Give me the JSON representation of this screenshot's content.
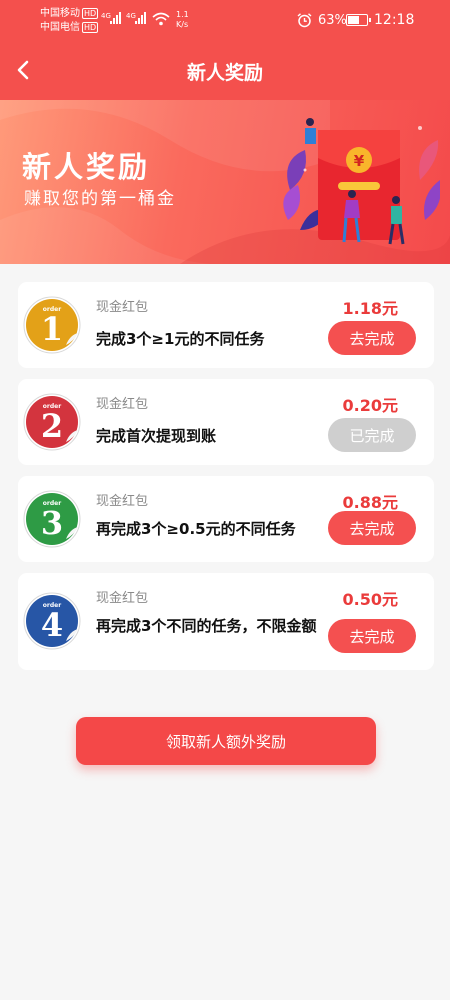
{
  "status_bar": {
    "carrier_1": "中国移动",
    "carrier_2": "中国电信",
    "hd_badge": "HD",
    "network_1": "4G",
    "network_2": "4G",
    "net_speed_value": "1.1",
    "net_speed_unit": "K/s",
    "battery": "63%",
    "battery_level": 0.63,
    "time": "12:18"
  },
  "nav": {
    "back_icon": "chevron-left-icon",
    "title": "新人奖励"
  },
  "banner": {
    "title": "新人奖励",
    "subtitle_prefix": "赚取您的",
    "subtitle_highlight": "第一桶金",
    "envelope_symbol": "¥"
  },
  "tasks": [
    {
      "order": "1",
      "badge_color": "#e3a118",
      "kind": "现金红包",
      "description": "完成3个≥1元的不同任务",
      "amount": "1.18元",
      "button": "去完成",
      "status": "todo"
    },
    {
      "order": "2",
      "badge_color": "#d3343e",
      "kind": "现金红包",
      "description": "完成首次提现到账",
      "amount": "0.20元",
      "button": "已完成",
      "status": "done"
    },
    {
      "order": "3",
      "badge_color": "#2e9b45",
      "kind": "现金红包",
      "description": "再完成3个≥0.5元的不同任务",
      "amount": "0.88元",
      "button": "去完成",
      "status": "todo"
    },
    {
      "order": "4",
      "badge_color": "#2756a6",
      "kind": "现金红包",
      "description": "再完成3个不同的任务，不限金额",
      "amount": "0.50元",
      "button": "去完成",
      "status": "todo"
    }
  ],
  "medal_label": "order",
  "claim_button": "领取新人额外奖励",
  "colors": {
    "header_bg": "#f4504d",
    "accent": "#f45050",
    "amount_text": "#ea3b3b",
    "done_button": "#cfcfcf",
    "page_bg": "#f6f6f6"
  }
}
